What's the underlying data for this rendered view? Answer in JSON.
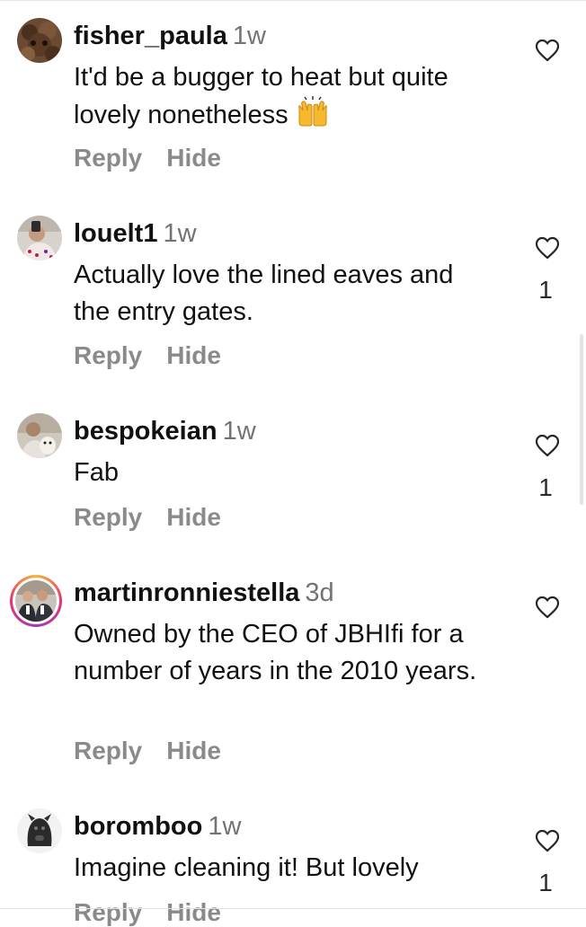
{
  "comments": [
    {
      "username": "fisher_paula",
      "time": "1w",
      "text": "It'd be a bugger to heat but quite lovely nonetheless",
      "emoji_icon": "raising-hands-emoji",
      "reply_label": "Reply",
      "hide_label": "Hide",
      "likes": ""
    },
    {
      "username": "louelt1",
      "time": "1w",
      "text": "Actually love the lined eaves and the entry gates.",
      "reply_label": "Reply",
      "hide_label": "Hide",
      "likes": "1"
    },
    {
      "username": "bespokeian",
      "time": "1w",
      "text": "Fab",
      "reply_label": "Reply",
      "hide_label": "Hide",
      "likes": "1"
    },
    {
      "username": "martinronniestella",
      "time": "3d",
      "text": "Owned by the CEO of JBHIfi for a number of years in the 2010 years.",
      "reply_label": "Reply",
      "hide_label": "Hide",
      "likes": ""
    },
    {
      "username": "boromboo",
      "time": "1w",
      "text": "Imagine cleaning it! But lovely",
      "reply_label": "Reply",
      "hide_label": "Hide",
      "likes": "1"
    }
  ],
  "colors": {
    "text": "#111111",
    "muted": "#737373",
    "action": "#8a8a8a",
    "story_ring": "#e8336f"
  }
}
